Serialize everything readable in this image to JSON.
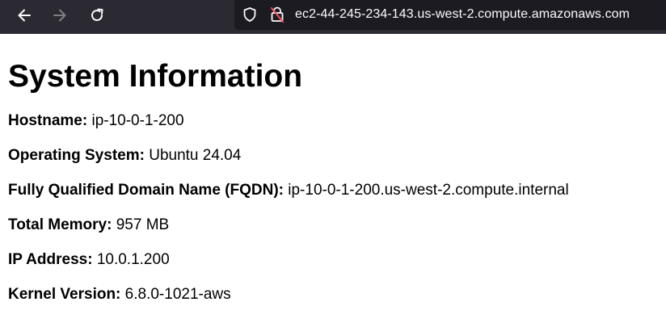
{
  "browser": {
    "url": "ec2-44-245-234-143.us-west-2.compute.amazonaws.com",
    "back_icon": "arrow-left-icon",
    "forward_icon": "arrow-right-icon",
    "reload_icon": "reload-icon",
    "shield_icon": "tracking-protection-shield-icon",
    "lock_icon": "insecure-lock-icon",
    "colors": {
      "toolbar_bg": "#2b2a33",
      "urlbar_bg": "#1c1b22",
      "insecure_lock": "#ff4f5e"
    }
  },
  "page": {
    "title": "System Information",
    "items": [
      {
        "label": "Hostname:",
        "value": "ip-10-0-1-200"
      },
      {
        "label": "Operating System:",
        "value": "Ubuntu 24.04"
      },
      {
        "label": "Fully Qualified Domain Name (FQDN):",
        "value": "ip-10-0-1-200.us-west-2.compute.internal"
      },
      {
        "label": "Total Memory:",
        "value": "957 MB"
      },
      {
        "label": "IP Address:",
        "value": "10.0.1.200"
      },
      {
        "label": "Kernel Version:",
        "value": "6.8.0-1021-aws"
      }
    ]
  }
}
